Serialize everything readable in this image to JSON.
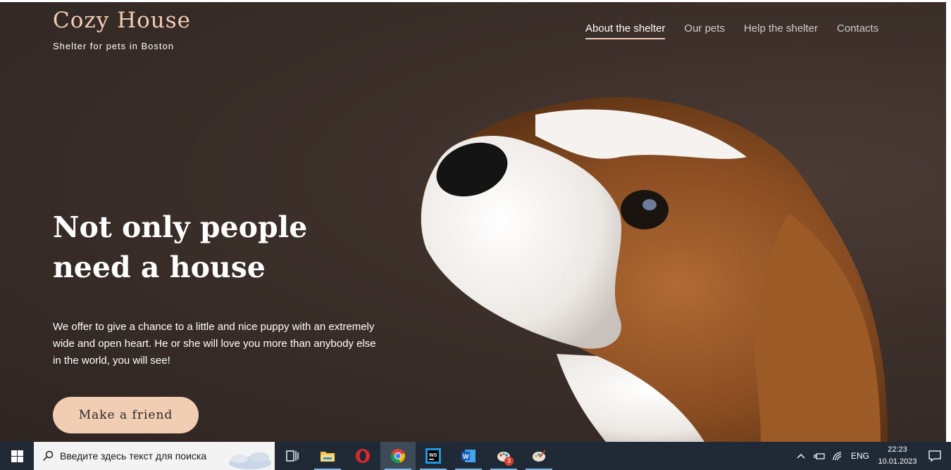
{
  "header": {
    "logo_title": "Cozy House",
    "logo_subtitle": "Shelter for pets in Boston",
    "nav": [
      {
        "label": "About the shelter",
        "active": true
      },
      {
        "label": "Our pets",
        "active": false
      },
      {
        "label": "Help the shelter",
        "active": false
      },
      {
        "label": "Contacts",
        "active": false
      }
    ]
  },
  "hero": {
    "headline_line1": "Not only people",
    "headline_line2": "need a house",
    "description": "We offer to give a chance to a little and nice puppy with an extremely wide and open heart. He or she will love you more than anybody else in the world, you will see!",
    "cta_label": "Make a friend"
  },
  "colors": {
    "accent": "#f1cdb3",
    "background": "#3d302b",
    "taskbar": "#1f2a36"
  },
  "taskbar": {
    "search_placeholder": "Введите здесь текст для поиска",
    "apps": [
      {
        "icon": "task-view-icon"
      },
      {
        "icon": "file-explorer-icon"
      },
      {
        "icon": "opera-icon"
      },
      {
        "icon": "chrome-icon",
        "active": true
      },
      {
        "icon": "webstorm-icon"
      },
      {
        "icon": "word-icon"
      },
      {
        "icon": "paint-badge-icon",
        "badge": "3"
      },
      {
        "icon": "paint-icon"
      }
    ],
    "tray": {
      "language": "ENG",
      "time": "22:23",
      "date": "10.01.2023"
    }
  }
}
